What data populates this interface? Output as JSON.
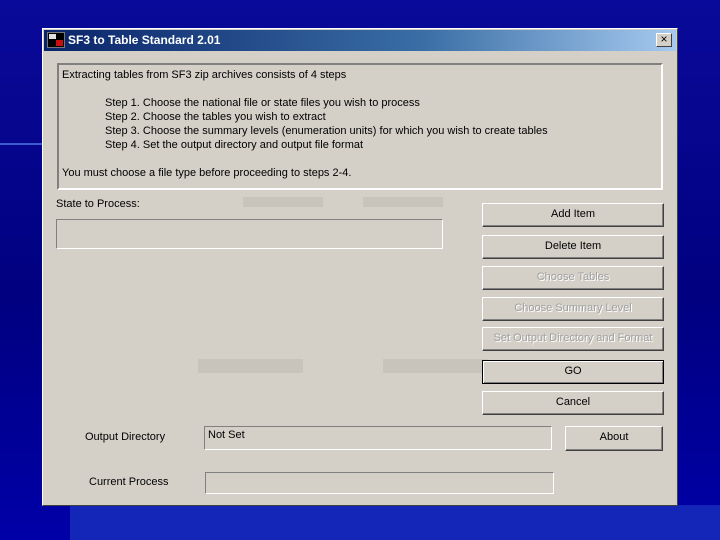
{
  "window": {
    "title": "SF3 to Table Standard 2.01",
    "close_glyph": "×"
  },
  "info": {
    "intro": "Extracting tables from SF3 zip archives consists of 4 steps",
    "steps": [
      "Step 1. Choose the national file or state files you wish to process",
      "Step 2. Choose the tables you wish to extract",
      "Step 3. Choose the summary levels (enumeration units) for which you wish to create tables",
      "Step 4. Set the output directory and output file format"
    ],
    "note": "You must choose a file type before proceeding to steps 2-4."
  },
  "state_label": "State to Process:",
  "buttons": {
    "add_item": "Add Item",
    "delete_item": "Delete Item",
    "choose_tables": "Choose Tables",
    "choose_summary": "Choose Summary Level",
    "set_output": "Set Output Directory and Format",
    "go": "GO",
    "cancel": "Cancel",
    "about": "About"
  },
  "output_dir": {
    "label": "Output Directory",
    "value": "Not Set"
  },
  "current_process": {
    "label": "Current Process",
    "value": ""
  }
}
